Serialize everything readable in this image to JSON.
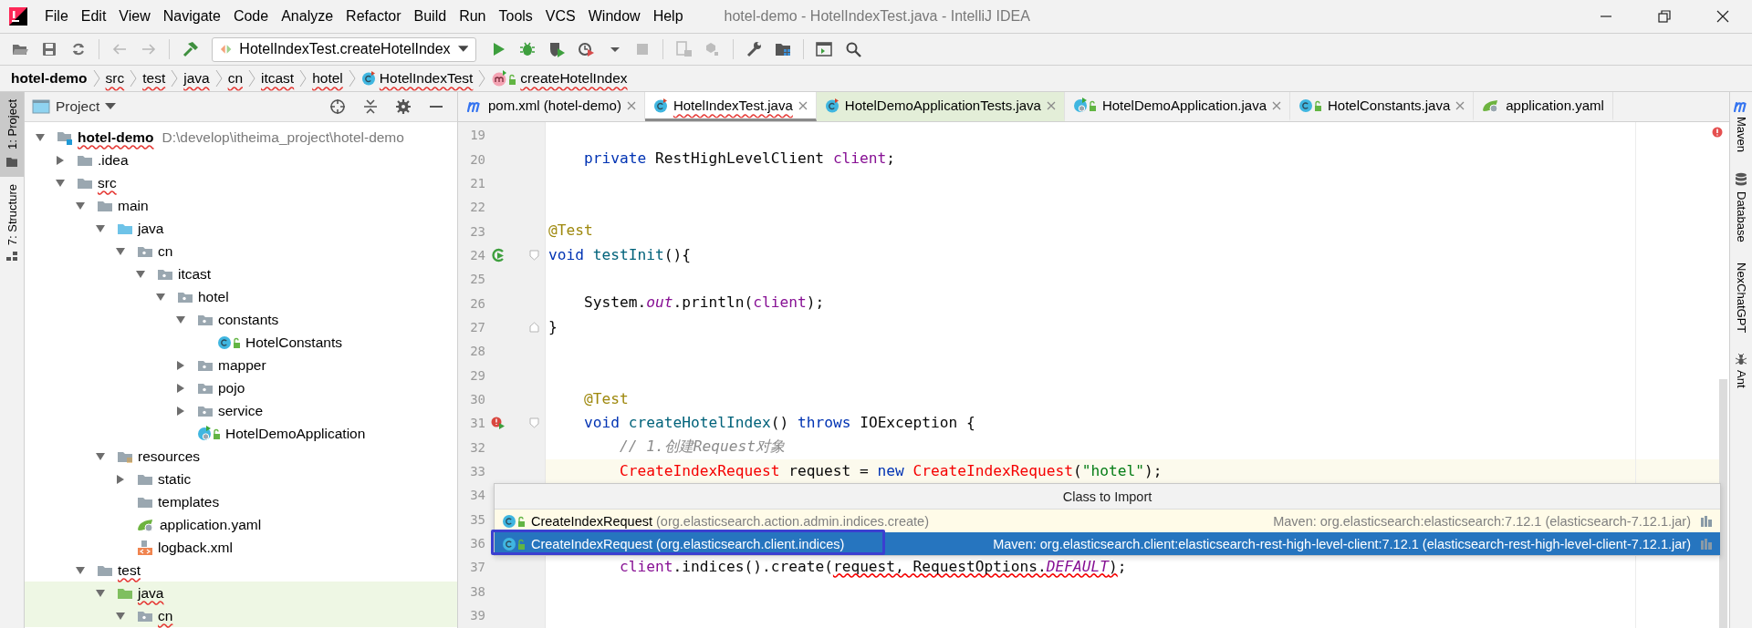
{
  "window": {
    "title": "hotel-demo - HotelIndexTest.java - IntelliJ IDEA"
  },
  "menu": [
    "File",
    "Edit",
    "View",
    "Navigate",
    "Code",
    "Analyze",
    "Refactor",
    "Build",
    "Run",
    "Tools",
    "VCS",
    "Window",
    "Help"
  ],
  "toolbar": {
    "run_config": "HotelIndexTest.createHotelIndex"
  },
  "breadcrumbs": [
    {
      "label": "hotel-demo",
      "kind": "module",
      "error": false
    },
    {
      "label": "src",
      "kind": "folder",
      "error": true
    },
    {
      "label": "test",
      "kind": "folder",
      "error": true
    },
    {
      "label": "java",
      "kind": "folder",
      "error": true
    },
    {
      "label": "cn",
      "kind": "folder",
      "error": true
    },
    {
      "label": "itcast",
      "kind": "folder",
      "error": true
    },
    {
      "label": "hotel",
      "kind": "folder",
      "error": true
    },
    {
      "label": "HotelIndexTest",
      "kind": "test-class",
      "error": true
    },
    {
      "label": "createHotelIndex",
      "kind": "method",
      "error": true
    }
  ],
  "left_stripe": [
    {
      "label": "1: Project",
      "kind": "project",
      "selected": true
    },
    {
      "label": "7: Structure",
      "kind": "structure",
      "selected": false
    }
  ],
  "project_panel": {
    "title": "Project",
    "tree": [
      {
        "label": "hotel-demo",
        "kind": "module",
        "hint": "D:\\develop\\itheima_project\\hotel-demo",
        "expanded": true,
        "error": true,
        "test_scope": false,
        "children": [
          {
            "label": ".idea",
            "kind": "folder",
            "expanded": false,
            "error": false,
            "test_scope": false
          },
          {
            "label": "src",
            "kind": "folder",
            "expanded": true,
            "error": true,
            "test_scope": false,
            "children": [
              {
                "label": "main",
                "kind": "folder",
                "expanded": true,
                "error": false,
                "test_scope": false,
                "children": [
                  {
                    "label": "java",
                    "kind": "source",
                    "expanded": true,
                    "error": false,
                    "test_scope": false,
                    "children": [
                      {
                        "label": "cn",
                        "kind": "package",
                        "expanded": true,
                        "error": false,
                        "test_scope": false,
                        "children": [
                          {
                            "label": "itcast",
                            "kind": "package",
                            "expanded": true,
                            "error": false,
                            "test_scope": false,
                            "children": [
                              {
                                "label": "hotel",
                                "kind": "package",
                                "expanded": true,
                                "error": false,
                                "test_scope": false,
                                "children": [
                                  {
                                    "label": "constants",
                                    "kind": "package",
                                    "expanded": true,
                                    "error": false,
                                    "test_scope": false,
                                    "children": [
                                      {
                                        "label": "HotelConstants",
                                        "kind": "class",
                                        "error": false,
                                        "test_scope": false
                                      }
                                    ]
                                  },
                                  {
                                    "label": "mapper",
                                    "kind": "package",
                                    "expanded": false,
                                    "error": false,
                                    "test_scope": false
                                  },
                                  {
                                    "label": "pojo",
                                    "kind": "package",
                                    "expanded": false,
                                    "error": false,
                                    "test_scope": false
                                  },
                                  {
                                    "label": "service",
                                    "kind": "package",
                                    "expanded": false,
                                    "error": false,
                                    "test_scope": false
                                  },
                                  {
                                    "label": "HotelDemoApplication",
                                    "kind": "app-class",
                                    "error": false,
                                    "test_scope": false
                                  }
                                ]
                              }
                            ]
                          }
                        ]
                      }
                    ]
                  },
                  {
                    "label": "resources",
                    "kind": "resources",
                    "expanded": true,
                    "error": false,
                    "test_scope": false,
                    "children": [
                      {
                        "label": "static",
                        "kind": "folder",
                        "expanded": false,
                        "error": false,
                        "test_scope": false
                      },
                      {
                        "label": "templates",
                        "kind": "folder",
                        "error": false,
                        "test_scope": false
                      },
                      {
                        "label": "application.yaml",
                        "kind": "yaml",
                        "error": false,
                        "test_scope": false
                      },
                      {
                        "label": "logback.xml",
                        "kind": "xml",
                        "error": false,
                        "test_scope": false
                      }
                    ]
                  }
                ]
              },
              {
                "label": "test",
                "kind": "folder",
                "expanded": true,
                "error": true,
                "test_scope": false,
                "children": [
                  {
                    "label": "java",
                    "kind": "test-source",
                    "expanded": true,
                    "error": true,
                    "test_scope": true,
                    "children": [
                      {
                        "label": "cn",
                        "kind": "package",
                        "expanded": true,
                        "error": true,
                        "test_scope": true
                      }
                    ]
                  }
                ]
              }
            ]
          }
        ]
      }
    ]
  },
  "editor": {
    "tabs": [
      {
        "label": "pom.xml (hotel-demo)",
        "kind": "maven",
        "selected": false,
        "test_scope": false,
        "error": false,
        "closable": true
      },
      {
        "label": "HotelIndexTest.java",
        "kind": "test-class",
        "selected": true,
        "test_scope": true,
        "error": true,
        "closable": true
      },
      {
        "label": "HotelDemoApplicationTests.java",
        "kind": "test-class",
        "selected": false,
        "test_scope": true,
        "error": false,
        "closable": true
      },
      {
        "label": "HotelDemoApplication.java",
        "kind": "app-class",
        "selected": false,
        "test_scope": false,
        "error": false,
        "closable": true
      },
      {
        "label": "HotelConstants.java",
        "kind": "class",
        "selected": false,
        "test_scope": false,
        "error": false,
        "closable": true
      },
      {
        "label": "application.yaml",
        "kind": "yaml",
        "selected": false,
        "test_scope": false,
        "error": false,
        "closable": false
      }
    ],
    "lines": [
      {
        "number": "19",
        "current": false,
        "run_icon": false,
        "fold_start": false,
        "fold_end": false
      },
      {
        "number": "20",
        "current": false,
        "run_icon": false,
        "fold_start": false,
        "fold_end": false,
        "tokens": [
          {
            "kind": "keyword",
            "text": "    private"
          },
          {
            "kind": "plain",
            "text": " RestHighLevelClient "
          },
          {
            "kind": "field",
            "text": "client"
          },
          {
            "kind": "plain",
            "text": ";"
          }
        ]
      },
      {
        "number": "21",
        "current": false,
        "run_icon": false,
        "fold_start": false,
        "fold_end": false
      },
      {
        "number": "22",
        "current": false,
        "run_icon": false,
        "fold_start": false,
        "fold_end": false
      },
      {
        "number": "23",
        "current": false,
        "run_icon": false,
        "fold_start": false,
        "fold_end": false,
        "tokens": [
          {
            "kind": "annotation",
            "text": "@Test"
          }
        ]
      },
      {
        "number": "24",
        "current": false,
        "run_icon": true,
        "run_failed": false,
        "fold_start": true,
        "fold_end": false,
        "tokens": [
          {
            "kind": "keyword",
            "text": "void "
          },
          {
            "kind": "method",
            "text": "testInit"
          },
          {
            "kind": "plain",
            "text": "(){"
          }
        ]
      },
      {
        "number": "25",
        "current": false,
        "run_icon": false,
        "fold_start": false,
        "fold_end": false
      },
      {
        "number": "26",
        "current": false,
        "run_icon": false,
        "fold_start": false,
        "fold_end": false,
        "tokens": [
          {
            "kind": "plain",
            "text": "    System."
          },
          {
            "kind": "static",
            "text": "out"
          },
          {
            "kind": "plain",
            "text": ".println("
          },
          {
            "kind": "field",
            "text": "client"
          },
          {
            "kind": "plain",
            "text": ");"
          }
        ]
      },
      {
        "number": "27",
        "current": false,
        "run_icon": false,
        "fold_start": false,
        "fold_end": true,
        "tokens": [
          {
            "kind": "plain",
            "text": "}"
          }
        ]
      },
      {
        "number": "28",
        "current": false,
        "run_icon": false,
        "fold_start": false,
        "fold_end": false
      },
      {
        "number": "29",
        "current": false,
        "run_icon": false,
        "fold_start": false,
        "fold_end": false
      },
      {
        "number": "30",
        "current": false,
        "run_icon": false,
        "fold_start": false,
        "fold_end": false,
        "tokens": [
          {
            "kind": "annotation",
            "text": "    @Test"
          }
        ]
      },
      {
        "number": "31",
        "current": false,
        "run_icon": true,
        "run_failed": true,
        "fold_start": true,
        "fold_end": false,
        "tokens": [
          {
            "kind": "keyword",
            "text": "    void "
          },
          {
            "kind": "method",
            "text": "createHotelIndex"
          },
          {
            "kind": "plain",
            "text": "() "
          },
          {
            "kind": "keyword",
            "text": "throws"
          },
          {
            "kind": "plain",
            "text": " IOException {"
          }
        ]
      },
      {
        "number": "32",
        "current": false,
        "run_icon": false,
        "fold_start": false,
        "fold_end": false,
        "tokens": [
          {
            "kind": "comment",
            "text": "        // 1.创建Request对象"
          }
        ]
      },
      {
        "number": "33",
        "current": true,
        "run_icon": false,
        "fold_start": false,
        "fold_end": false,
        "tokens": [
          {
            "kind": "unresolved",
            "text": "        CreateIndexRequest"
          },
          {
            "kind": "plain",
            "text": " request = "
          },
          {
            "kind": "keyword",
            "text": "new "
          },
          {
            "kind": "unresolved",
            "text": "CreateIndexRequest"
          },
          {
            "kind": "plain",
            "text": "("
          },
          {
            "kind": "string",
            "text": "\"hotel\""
          },
          {
            "kind": "plain",
            "text": ");"
          }
        ]
      },
      {
        "number": "34",
        "current": false,
        "run_icon": false,
        "fold_start": false,
        "fold_end": false
      },
      {
        "number": "35",
        "current": false,
        "run_icon": false,
        "fold_start": false,
        "fold_end": false
      },
      {
        "number": "36",
        "current": false,
        "run_icon": false,
        "fold_start": false,
        "fold_end": false
      },
      {
        "number": "37",
        "current": false,
        "run_icon": false,
        "fold_start": false,
        "fold_end": false,
        "tokens": [
          {
            "kind": "field",
            "text": "        client"
          },
          {
            "kind": "plain",
            "text": ".indices().create("
          },
          {
            "kind": "squiggle",
            "text": "request, RequestOptions."
          },
          {
            "kind": "static-squiggle",
            "text": "DEFAULT"
          },
          {
            "kind": "squiggle",
            "text": ")"
          },
          {
            "kind": "plain",
            "text": ";"
          }
        ]
      },
      {
        "number": "38",
        "current": false,
        "run_icon": false,
        "fold_start": false,
        "fold_end": false
      },
      {
        "number": "39",
        "current": false,
        "run_icon": false,
        "fold_start": false,
        "fold_end": false
      }
    ],
    "import_popup": {
      "title": "Class to Import",
      "rows": [
        {
          "name": "CreateIndexRequest",
          "package": "(org.elasticsearch.action.admin.indices.create)",
          "source": "Maven: org.elasticsearch:elasticsearch:7.12.1 (elasticsearch-7.12.1.jar)",
          "selected": false
        },
        {
          "name": "CreateIndexRequest",
          "package": "(org.elasticsearch.client.indices)",
          "source": "Maven: org.elasticsearch.client:elasticsearch-rest-high-level-client:7.12.1 (elasticsearch-rest-high-level-client-7.12.1.jar)",
          "selected": true
        }
      ]
    }
  },
  "right_stripe": [
    {
      "label": "Maven",
      "kind": "maven"
    },
    {
      "label": "Database",
      "kind": "database"
    },
    {
      "label": "NexChatGPT",
      "kind": "none"
    },
    {
      "label": "Ant",
      "kind": "ant"
    }
  ]
}
